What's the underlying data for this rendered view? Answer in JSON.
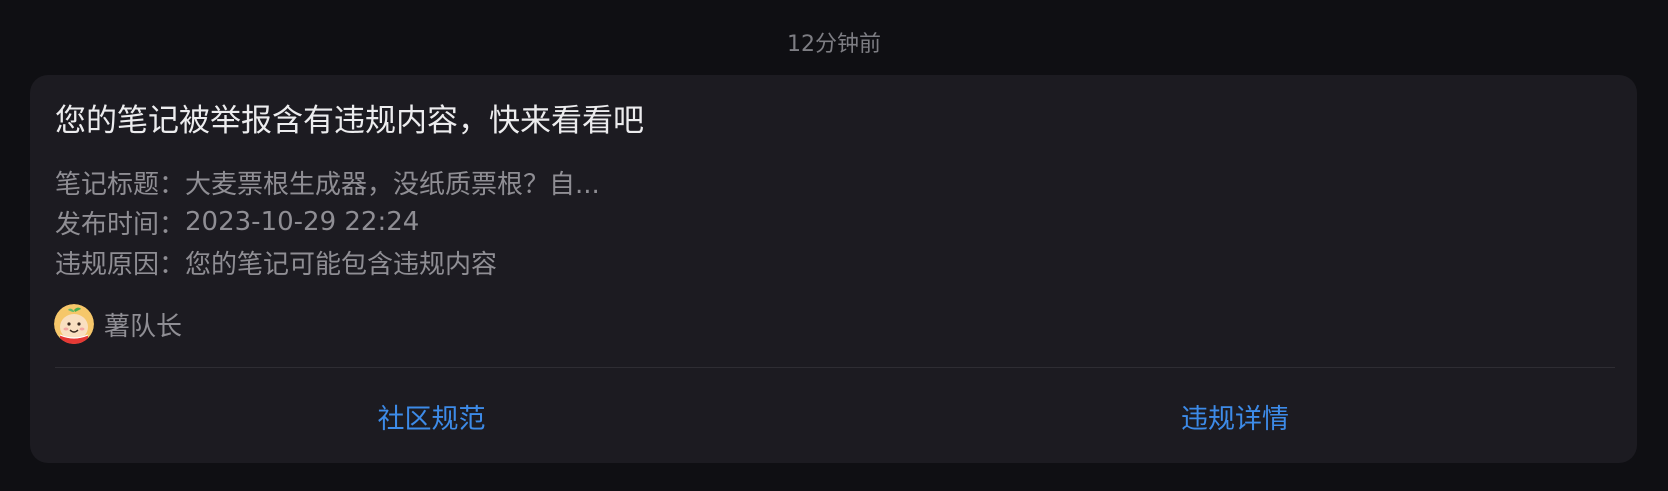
{
  "timestamp": "12分钟前",
  "notification": {
    "title": "您的笔记被举报含有违规内容，快来看看吧",
    "details": [
      {
        "label": "笔记标题：",
        "value": "大麦票根生成器，没纸质票根？自..."
      },
      {
        "label": "发布时间：",
        "value": "2023-10-29 22:24"
      },
      {
        "label": "违规原因：",
        "value": "您的笔记可能包含违规内容"
      }
    ],
    "sender": {
      "avatar_icon": "potato-mascot-avatar",
      "name": "薯队长"
    },
    "actions": {
      "community_guidelines_label": "社区规范",
      "violation_details_label": "违规详情"
    }
  },
  "colors": {
    "background": "#0f0f13",
    "card": "#1c1b21",
    "title_text": "#ececee",
    "secondary_text": "#8f8e94",
    "link_blue": "#3d8be8",
    "avatar_bg": "#f6c76a"
  }
}
